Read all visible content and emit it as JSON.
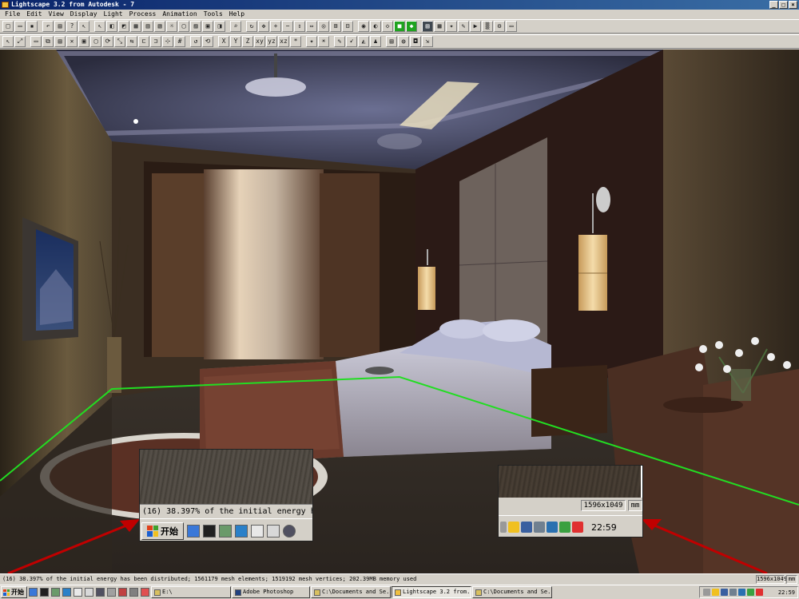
{
  "window": {
    "title": "Lightscape 3.2 from Autodesk - 7",
    "buttons": [
      "_",
      "□",
      "×"
    ]
  },
  "menu": [
    "File",
    "Edit",
    "View",
    "Display",
    "Light",
    "Process",
    "Animation",
    "Tools",
    "Help"
  ],
  "status": {
    "message": "(16) 38.397% of the initial energy has been distributed; 1561179 mesh elements; 1519192 mesh vertices; 202.39MB memory used",
    "resolution": "1596x1049",
    "unit": "mm"
  },
  "zoom_left": {
    "status_text": "(16) 38.397% of the initial energy h",
    "start_label": "开始"
  },
  "zoom_right": {
    "resolution": "1596x1049",
    "unit": "mm",
    "clock": "22:59"
  },
  "taskbar": {
    "start_label": "开始",
    "tasks": [
      {
        "label": "E:\\"
      },
      {
        "label": "Adobe Photoshop"
      },
      {
        "label": "C:\\Documents and Se..."
      },
      {
        "label": "Lightscape 3.2 from..."
      },
      {
        "label": "C:\\Documents and Se..."
      }
    ],
    "clock": "22:59"
  },
  "colors": {
    "titlebar": "#0a246a",
    "chrome": "#d4d0c8",
    "guide_line": "#22dd22",
    "arrow": "#c00000"
  }
}
